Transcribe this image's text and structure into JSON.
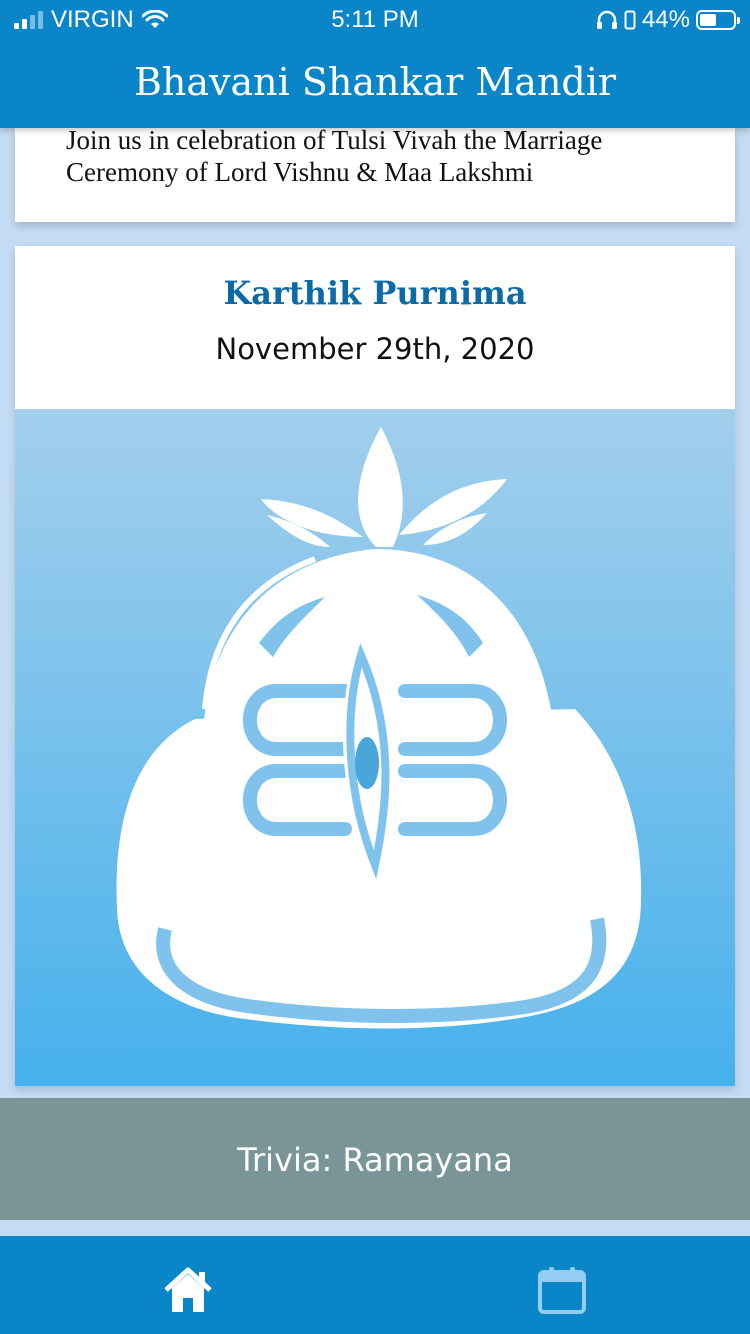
{
  "status_bar": {
    "carrier": "VIRGIN",
    "time": "5:11 PM",
    "battery": "44%",
    "battery_level": 0.44
  },
  "header": {
    "title": "Bhavani Shankar Mandir"
  },
  "cards": {
    "tulsi": {
      "text": "Join us in celebration of Tulsi Vivah the Marriage Ceremony of Lord Vishnu & Maa Lakshmi"
    },
    "event": {
      "title": "Karthik Purnima",
      "date": "November 29th, 2020",
      "image_icon": "shiva-lingam-icon"
    }
  },
  "trivia": {
    "label": "Trivia: Ramayana"
  },
  "tab_bar": {
    "items": [
      {
        "name": "home",
        "icon": "home-icon"
      },
      {
        "name": "calendar",
        "icon": "calendar-icon"
      }
    ]
  },
  "colors": {
    "primary": "#0a86c8",
    "title_blue": "#0d6aa8",
    "trivia_bg": "#7a9598",
    "page_bg": "#c4dcf3"
  }
}
